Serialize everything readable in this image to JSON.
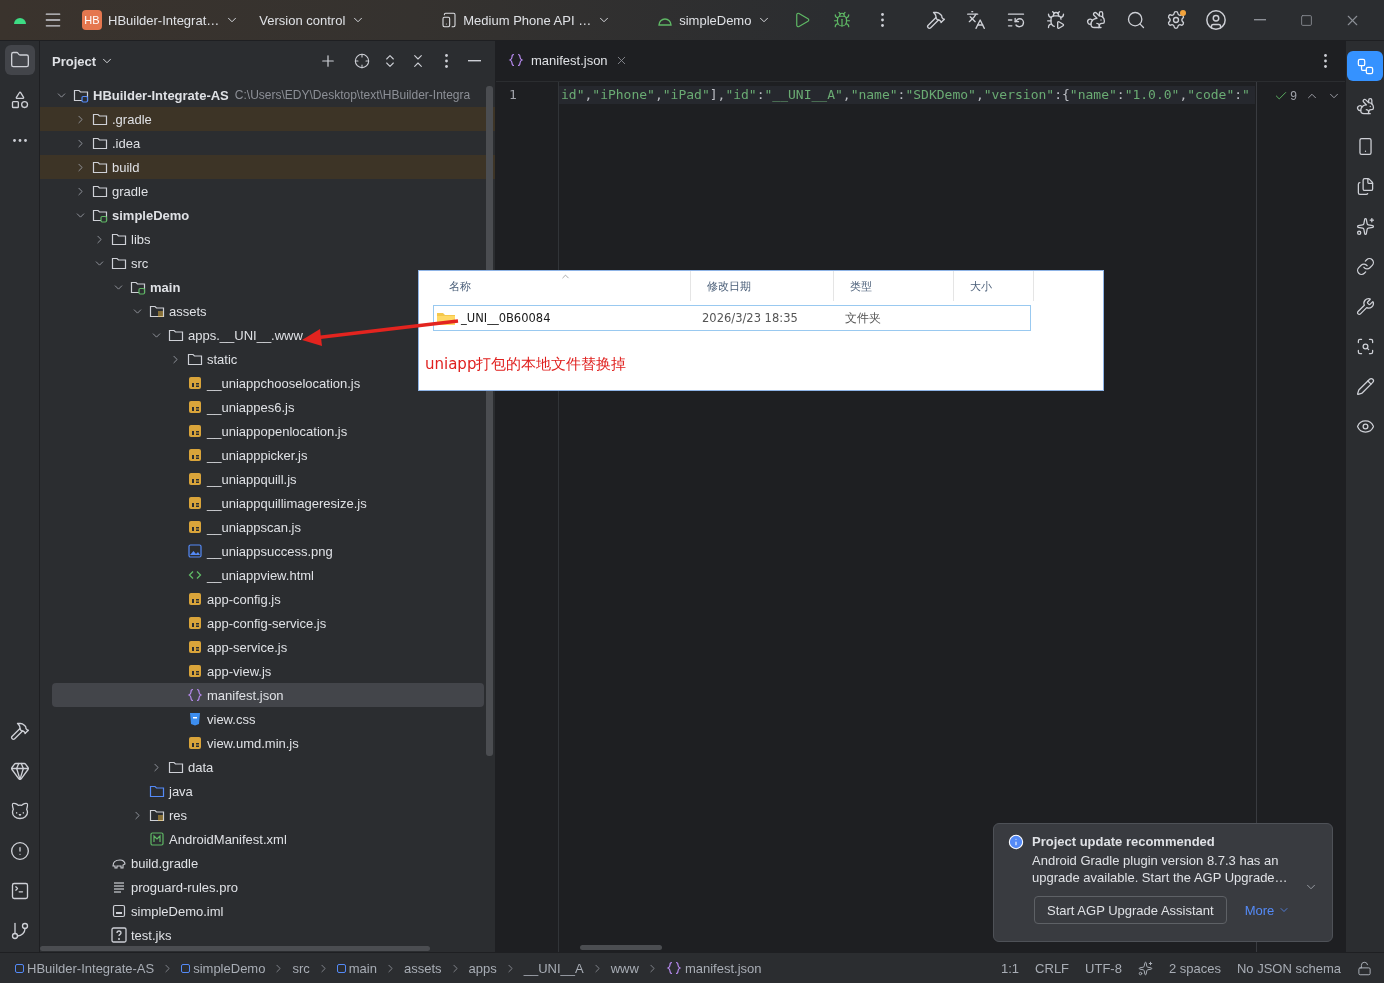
{
  "title_bar": {
    "project_badge": "HB",
    "project": "HBuilder-Integrat…",
    "vcs": "Version control",
    "device": "Medium Phone API …",
    "run_config": "simpleDemo"
  },
  "left_strip": {
    "top": [
      {
        "kind": "project",
        "selected": true
      },
      {
        "kind": "structure",
        "selected": false
      },
      {
        "kind": "more",
        "selected": false
      }
    ],
    "bottom": [
      {
        "kind": "build",
        "selected": false
      },
      {
        "kind": "gem",
        "selected": false
      },
      {
        "kind": "cat",
        "selected": false
      },
      {
        "kind": "problems",
        "selected": false
      },
      {
        "kind": "terminal",
        "selected": false
      },
      {
        "kind": "git",
        "selected": false
      }
    ]
  },
  "project_panel": {
    "title": "Project",
    "tree": [
      {
        "label": "HBuilder-Integrate-AS",
        "path": "C:\\Users\\EDY\\Desktop\\text\\HBuilder-Integra",
        "kind": "project",
        "bold": true,
        "expanded": true,
        "selected": false,
        "excluded": false,
        "children": [
          {
            "label": ".gradle",
            "kind": "folder",
            "expanded": false,
            "selected": false,
            "excluded": true
          },
          {
            "label": ".idea",
            "kind": "folder",
            "expanded": false,
            "selected": false,
            "excluded": false
          },
          {
            "label": "build",
            "kind": "folder",
            "expanded": false,
            "selected": false,
            "excluded": true
          },
          {
            "label": "gradle",
            "kind": "folder",
            "expanded": false,
            "selected": false,
            "excluded": false
          },
          {
            "label": "simpleDemo",
            "kind": "module",
            "bold": true,
            "expanded": true,
            "selected": false,
            "excluded": false,
            "children": [
              {
                "label": "libs",
                "kind": "folder",
                "expanded": false,
                "selected": false,
                "excluded": false
              },
              {
                "label": "src",
                "kind": "folder",
                "expanded": true,
                "selected": false,
                "excluded": false,
                "children": [
                  {
                    "label": "main",
                    "kind": "module",
                    "bold": true,
                    "expanded": true,
                    "selected": false,
                    "excluded": false,
                    "children": [
                      {
                        "label": "assets",
                        "kind": "resources",
                        "expanded": true,
                        "selected": false,
                        "excluded": false,
                        "children": [
                          {
                            "label": "apps.__UNI__.www",
                            "kind": "folder",
                            "expanded": true,
                            "selected": false,
                            "excluded": false,
                            "children": [
                              {
                                "label": "static",
                                "kind": "folder",
                                "expanded": false,
                                "selected": false,
                                "excluded": false
                              },
                              {
                                "label": "__uniappchooselocation.js",
                                "kind": "js",
                                "selected": false,
                                "excluded": false
                              },
                              {
                                "label": "__uniappes6.js",
                                "kind": "js",
                                "selected": false,
                                "excluded": false
                              },
                              {
                                "label": "__uniappopenlocation.js",
                                "kind": "js",
                                "selected": false,
                                "excluded": false
                              },
                              {
                                "label": "__uniapppicker.js",
                                "kind": "js",
                                "selected": false,
                                "excluded": false
                              },
                              {
                                "label": "__uniappquill.js",
                                "kind": "js",
                                "selected": false,
                                "excluded": false
                              },
                              {
                                "label": "__uniappquillimageresize.js",
                                "kind": "js",
                                "selected": false,
                                "excluded": false
                              },
                              {
                                "label": "__uniappscan.js",
                                "kind": "js",
                                "selected": false,
                                "excluded": false
                              },
                              {
                                "label": "__uniappsuccess.png",
                                "kind": "image",
                                "selected": false,
                                "excluded": false
                              },
                              {
                                "label": "__uniappview.html",
                                "kind": "html",
                                "selected": false,
                                "excluded": false
                              },
                              {
                                "label": "app-config.js",
                                "kind": "js",
                                "selected": false,
                                "excluded": false
                              },
                              {
                                "label": "app-config-service.js",
                                "kind": "js",
                                "selected": false,
                                "excluded": false
                              },
                              {
                                "label": "app-service.js",
                                "kind": "js",
                                "selected": false,
                                "excluded": false
                              },
                              {
                                "label": "app-view.js",
                                "kind": "js",
                                "selected": false,
                                "excluded": false
                              },
                              {
                                "label": "manifest.json",
                                "kind": "json",
                                "selected": true,
                                "excluded": false
                              },
                              {
                                "label": "view.css",
                                "kind": "css",
                                "selected": false,
                                "excluded": false
                              },
                              {
                                "label": "view.umd.min.js",
                                "kind": "js",
                                "selected": false,
                                "excluded": false
                              }
                            ]
                          },
                          {
                            "label": "data",
                            "kind": "folder",
                            "expanded": false,
                            "selected": false,
                            "excluded": false
                          }
                        ]
                      },
                      {
                        "label": "java",
                        "kind": "source",
                        "selected": false,
                        "excluded": false
                      },
                      {
                        "label": "res",
                        "kind": "resources",
                        "expanded": false,
                        "selected": false,
                        "excluded": false
                      },
                      {
                        "label": "AndroidManifest.xml",
                        "kind": "xml",
                        "selected": false,
                        "excluded": false
                      }
                    ]
                  }
                ]
              },
              {
                "label": "build.gradle",
                "kind": "gradle",
                "selected": false,
                "excluded": false
              },
              {
                "label": "proguard-rules.pro",
                "kind": "text",
                "selected": false,
                "excluded": false
              },
              {
                "label": "simpleDemo.iml",
                "kind": "iml",
                "selected": false,
                "excluded": false
              },
              {
                "label": "test.jks",
                "kind": "jks",
                "selected": false,
                "excluded": false
              }
            ]
          }
        ]
      }
    ]
  },
  "editor": {
    "tab": {
      "label": "manifest.json",
      "selected": true
    },
    "line_number": "1",
    "problems": "9",
    "code": [
      {
        "kind": "string",
        "text": "id\""
      },
      {
        "kind": "punct",
        "text": ","
      },
      {
        "kind": "string",
        "text": "\"iPhone\""
      },
      {
        "kind": "punct",
        "text": ","
      },
      {
        "kind": "string",
        "text": "\"iPad\""
      },
      {
        "kind": "punct",
        "text": "],"
      },
      {
        "kind": "string",
        "text": "\"id\""
      },
      {
        "kind": "punct",
        "text": ":"
      },
      {
        "kind": "string",
        "text": "\"__UNI__A\""
      },
      {
        "kind": "punct",
        "text": ","
      },
      {
        "kind": "string",
        "text": "\"name\""
      },
      {
        "kind": "punct",
        "text": ":"
      },
      {
        "kind": "string",
        "text": "\"SDKDemo\""
      },
      {
        "kind": "punct",
        "text": ","
      },
      {
        "kind": "string",
        "text": "\"version\""
      },
      {
        "kind": "punct",
        "text": ":{"
      },
      {
        "kind": "string",
        "text": "\"name\""
      },
      {
        "kind": "punct",
        "text": ":"
      },
      {
        "kind": "string",
        "text": "\"1.0.0\""
      },
      {
        "kind": "punct",
        "text": ","
      },
      {
        "kind": "string",
        "text": "\"code\""
      },
      {
        "kind": "punct",
        "text": ":"
      },
      {
        "kind": "string",
        "text": "\""
      }
    ]
  },
  "right_strip": [
    {
      "kind": "flow",
      "selected": true
    },
    {
      "kind": "gradle",
      "selected": false
    },
    {
      "kind": "device",
      "selected": false
    },
    {
      "kind": "files",
      "selected": false
    },
    {
      "kind": "sparkle",
      "selected": false
    },
    {
      "kind": "link",
      "selected": false
    },
    {
      "kind": "tools",
      "selected": false
    },
    {
      "kind": "inspect",
      "selected": false
    },
    {
      "kind": "edit",
      "selected": false
    },
    {
      "kind": "preview",
      "selected": false
    }
  ],
  "explorer": {
    "columns": [
      "名称",
      "修改日期",
      "类型",
      "大小"
    ],
    "rows": [
      {
        "name": "_UNI__0B60084",
        "modified": "2026/3/23 18:35",
        "type": "文件夹",
        "selected": true
      }
    ],
    "note": "uniapp打包的本地文件替换掉"
  },
  "notification": {
    "title": "Project update recommended",
    "body": "Android Gradle plugin version 8.7.3 has an upgrade available. Start the AGP Upgrade…",
    "action": "Start AGP Upgrade Assistant",
    "more": "More"
  },
  "status_bar": {
    "breadcrumbs": [
      {
        "label": "HBuilder-Integrate-AS",
        "kind": "module"
      },
      {
        "label": "simpleDemo",
        "kind": "module"
      },
      {
        "label": "src",
        "kind": "plain"
      },
      {
        "label": "main",
        "kind": "module"
      },
      {
        "label": "assets",
        "kind": "plain"
      },
      {
        "label": "apps",
        "kind": "plain"
      },
      {
        "label": "__UNI__A",
        "kind": "plain"
      },
      {
        "label": "www",
        "kind": "plain"
      },
      {
        "label": "manifest.json",
        "kind": "json"
      }
    ],
    "position": "1:1",
    "line_separator": "CRLF",
    "encoding": "UTF-8",
    "indent": "2 spaces",
    "schema": "No JSON schema"
  }
}
